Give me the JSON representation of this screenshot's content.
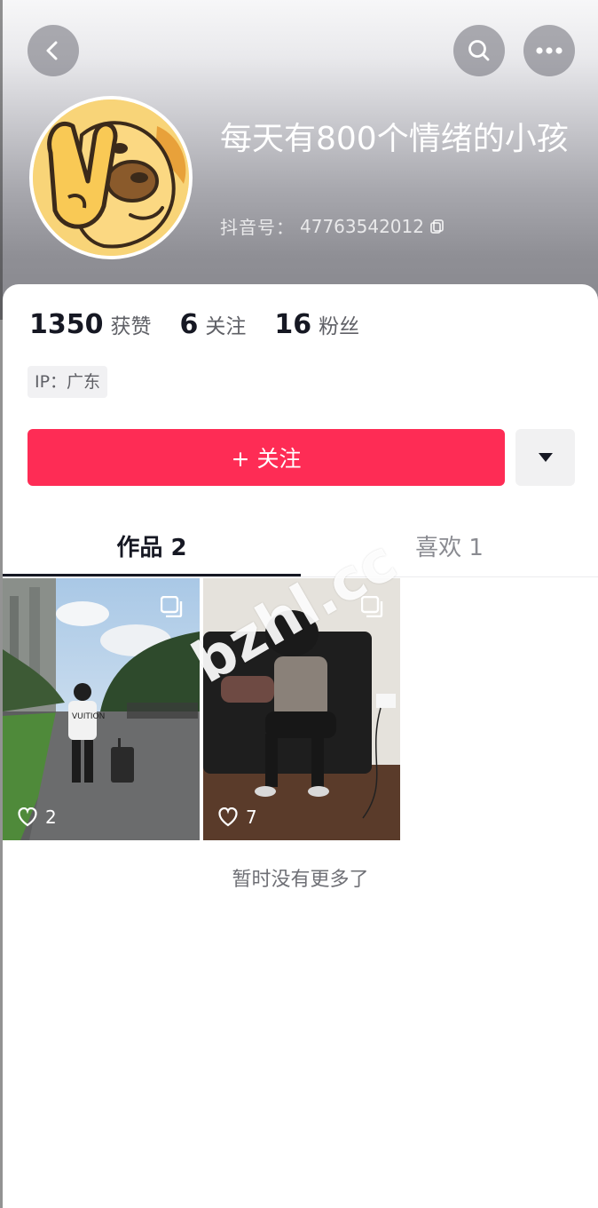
{
  "header": {
    "nickname": "每天有800个情绪的小孩",
    "douyin_id_label": "抖音号：",
    "douyin_id": "47763542012"
  },
  "stats": [
    {
      "num": "1350",
      "label": "获赞"
    },
    {
      "num": "6",
      "label": "关注"
    },
    {
      "num": "16",
      "label": "粉丝"
    }
  ],
  "ip_tag": "IP：广东",
  "follow_button": "+ 关注",
  "tabs": {
    "works": "作品 2",
    "likes": "喜欢 1"
  },
  "posts": [
    {
      "likes": "2",
      "shirt_text": "VUITION"
    },
    {
      "likes": "7"
    }
  ],
  "no_more_text": "暂时没有更多了",
  "watermark": "bzhl.cc",
  "colors": {
    "accent": "#fe2c55",
    "text_primary": "#161823",
    "text_secondary": "#8a8b91"
  },
  "icons": [
    "back-icon",
    "search-icon",
    "more-icon",
    "copy-icon",
    "chevron-down-icon",
    "multi-image-icon",
    "heart-icon"
  ]
}
